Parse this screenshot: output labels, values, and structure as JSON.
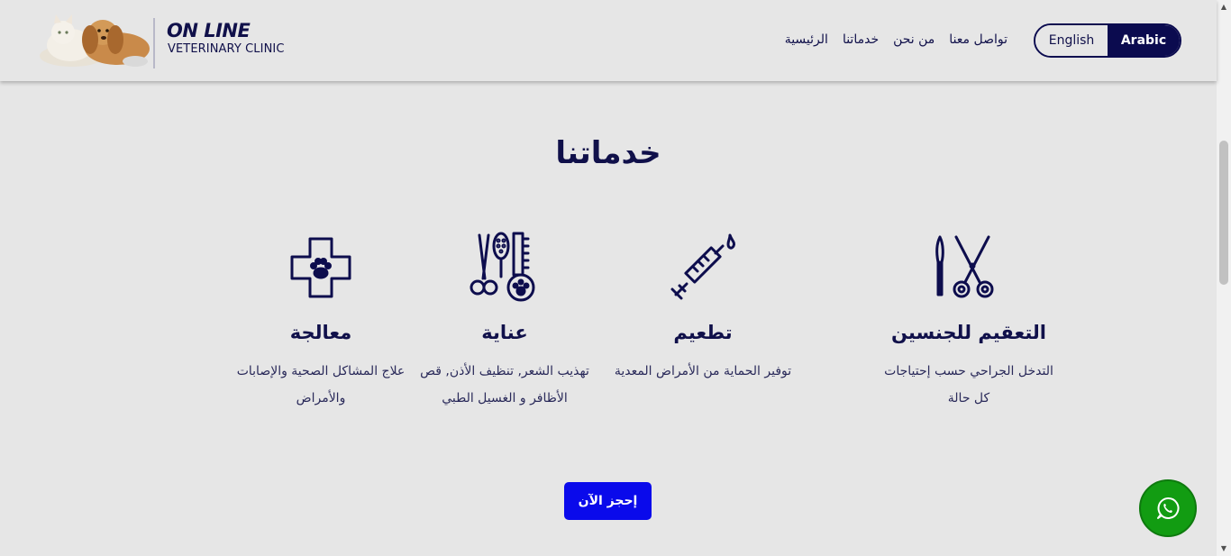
{
  "header": {
    "logo_title": "ON LINE",
    "logo_subtitle": "VETERINARY CLINIC",
    "nav": [
      "تواصل معنا",
      "من نحن",
      "خدماتنا",
      "الرئيسية"
    ],
    "lang": {
      "english": "English",
      "arabic": "Arabic",
      "active": "Arabic"
    }
  },
  "section": {
    "title": "خدماتنا"
  },
  "services": [
    {
      "title": "التعقيم للجنسين",
      "desc": "التدخل الجراحي حسب إحتياجات كل حالة",
      "icon": "surgical-scissors-icon"
    },
    {
      "title": "تطعيم",
      "desc": "توفير الحماية من الأمراض المعدية",
      "icon": "syringe-icon"
    },
    {
      "title": "عناية",
      "desc": "تهذيب الشعر, تنظيف الأذن, قص الأظافر و الغسيل الطبي",
      "icon": "grooming-tools-icon"
    },
    {
      "title": "معالجة",
      "desc": "علاج المشاكل الصحية والإصابات والأمراض",
      "icon": "medical-cross-paw-icon"
    }
  ],
  "cta": {
    "book_label": "إحجز الآن"
  },
  "colors": {
    "primary": "#10104a",
    "button": "#0a0aeb",
    "whatsapp": "#129c12",
    "background": "#e6e6e6"
  }
}
